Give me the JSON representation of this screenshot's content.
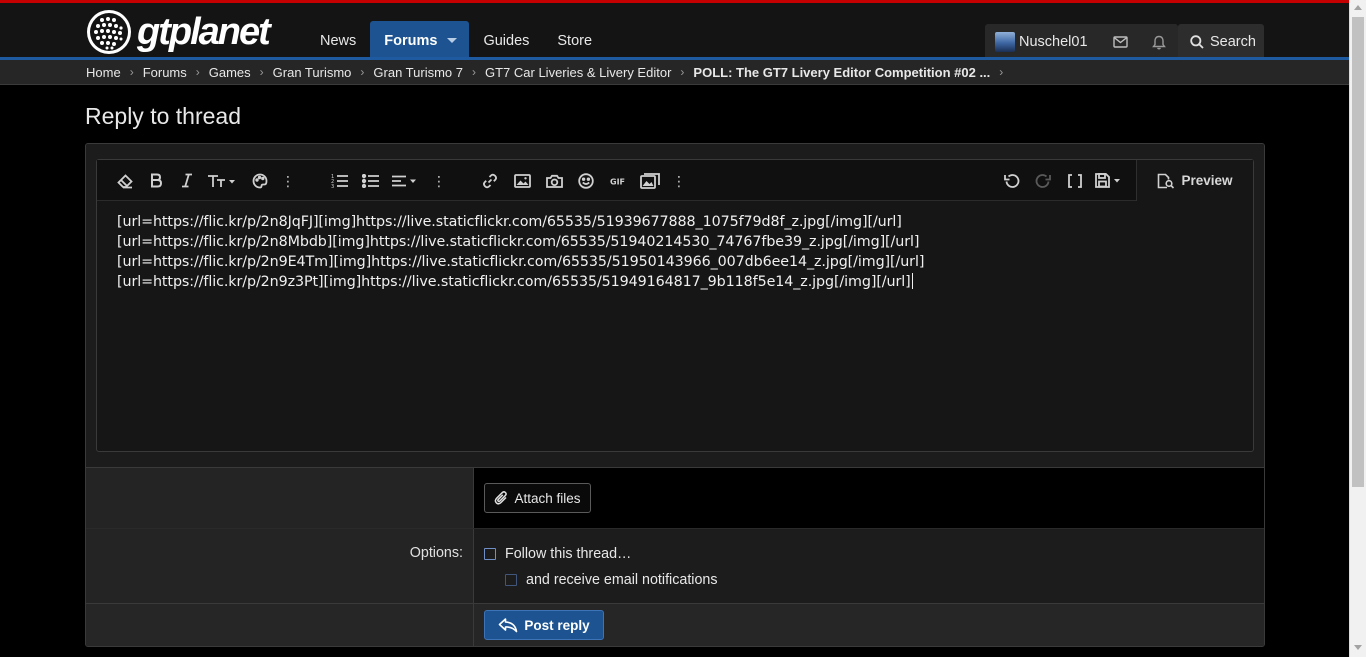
{
  "header": {
    "logo_text": "gtplanet",
    "nav": [
      {
        "label": "News",
        "active": false
      },
      {
        "label": "Forums",
        "active": true
      },
      {
        "label": "Guides",
        "active": false
      },
      {
        "label": "Store",
        "active": false
      }
    ],
    "username": "Nuschel01",
    "search_label": "Search"
  },
  "breadcrumb": [
    "Home",
    "Forums",
    "Games",
    "Gran Turismo",
    "Gran Turismo 7",
    "GT7 Car Liveries & Livery Editor",
    "POLL: The GT7 Livery Editor Competition #02 ..."
  ],
  "page": {
    "title": "Reply to thread"
  },
  "editor": {
    "preview_label": "Preview",
    "lines": [
      "[url=https://flic.kr/p/2n8JqFJ][img]https://live.staticflickr.com/65535/51939677888_1075f79d8f_z.jpg[/img][/url]",
      "[url=https://flic.kr/p/2n8Mbdb][img]https://live.staticflickr.com/65535/51940214530_74767fbe39_z.jpg[/img][/url]",
      "[url=https://flic.kr/p/2n9E4Tm][img]https://live.staticflickr.com/65535/51950143966_007db6ee14_z.jpg[/img][/url]",
      "[url=https://flic.kr/p/2n9z3Pt][img]https://live.staticflickr.com/65535/51949164817_9b118f5e14_z.jpg[/img][/url]"
    ]
  },
  "form": {
    "attach_label": "Attach files",
    "options_label": "Options:",
    "follow_label": "Follow this thread…",
    "email_label": "and receive email notifications",
    "submit_label": "Post reply"
  },
  "colors": {
    "accent_red": "#c40000",
    "accent_blue": "#1c5390",
    "background": "#000000"
  }
}
